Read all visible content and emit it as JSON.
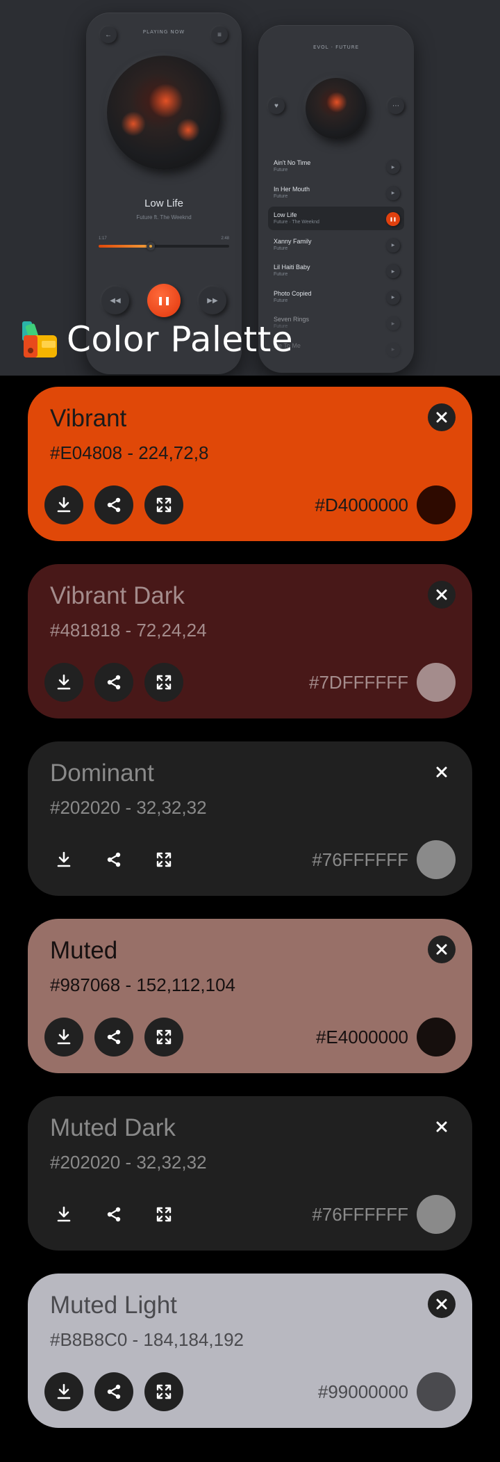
{
  "header": {
    "app_title": "Color Palette",
    "player": {
      "top_label": "PLAYING NOW",
      "song": "Low Life",
      "artist": "Future ft. The Weeknd",
      "time_elapsed": "1:17",
      "time_total": "2:48",
      "progress": 0.4
    },
    "playlist": {
      "top_label": "EVOL · FUTURE",
      "items": [
        {
          "name": "Ain't No Time",
          "sub": "Future"
        },
        {
          "name": "In Her Mouth",
          "sub": "Future"
        },
        {
          "name": "Low Life",
          "sub": "Future · The Weeknd"
        },
        {
          "name": "Xanny Family",
          "sub": "Future"
        },
        {
          "name": "Lil Haiti Baby",
          "sub": "Future"
        },
        {
          "name": "Photo Copied",
          "sub": "Future"
        },
        {
          "name": "Seven Rings",
          "sub": "Future"
        },
        {
          "name": "Lie To Me",
          "sub": ""
        }
      ]
    }
  },
  "colors": {
    "vibrant": "#E04808",
    "vibrant_dark": "#481818",
    "dominant": "#202020",
    "muted": "#987068",
    "muted_dark": "#202020",
    "muted_light": "#B8B8C0"
  },
  "cards": [
    {
      "name": "Vibrant",
      "hex": "#E04808 - 224,72,8",
      "argb": "#D4000000",
      "bg": "#E04808",
      "text": "#1A1A1A",
      "swatch": "#2E0A00",
      "icon_style": "dark"
    },
    {
      "name": "Vibrant Dark",
      "hex": "#481818 - 72,24,24",
      "argb": "#7DFFFFFF",
      "bg": "#481818",
      "text": "#A48C8C",
      "swatch": "#A48C8C",
      "icon_style": "dark"
    },
    {
      "name": "Dominant",
      "hex": "#202020 - 32,32,32",
      "argb": "#76FFFFFF",
      "bg": "#202020",
      "text": "#8A8A8A",
      "swatch": "#8A8A8A",
      "icon_style": "flat"
    },
    {
      "name": "Muted",
      "hex": "#987068 - 152,112,104",
      "argb": "#E4000000",
      "bg": "#987068",
      "text": "#161010",
      "swatch": "#160F0D",
      "icon_style": "dark"
    },
    {
      "name": "Muted Dark",
      "hex": "#202020 - 32,32,32",
      "argb": "#76FFFFFF",
      "bg": "#202020",
      "text": "#8A8A8A",
      "swatch": "#8A8A8A",
      "icon_style": "flat"
    },
    {
      "name": "Muted Light",
      "hex": "#B8B8C0 - 184,184,192",
      "argb": "#99000000",
      "bg": "#B8B8C0",
      "text": "#4A4A4E",
      "swatch": "#4A4A4E",
      "icon_style": "dark"
    }
  ],
  "icons": {
    "close": "close-icon",
    "download": "download-icon",
    "share": "share-icon",
    "expand": "expand-icon"
  }
}
